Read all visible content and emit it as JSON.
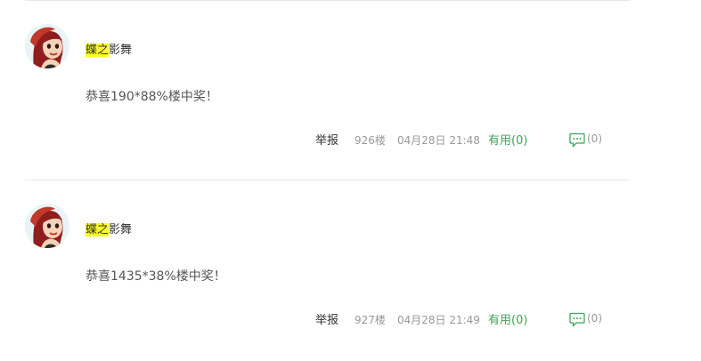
{
  "posts": [
    {
      "user": {
        "name_highlight": "蝶之",
        "name_rest": "影舞"
      },
      "content": "恭喜190*88%楼中奖！",
      "report_label": "举报",
      "floor": "926楼",
      "time": "04月28日 21:48",
      "useful_label": "有用(0)",
      "comment_count": "(0)"
    },
    {
      "user": {
        "name_highlight": "蝶之",
        "name_rest": "影舞"
      },
      "content": "恭喜1435*38%楼中奖！",
      "report_label": "举报",
      "floor": "927楼",
      "time": "04月28日 21:49",
      "useful_label": "有用(0)",
      "comment_count": "(0)"
    }
  ],
  "colors": {
    "highlight": "#ffff22",
    "useful": "#3aa757",
    "meta": "#999999",
    "divider": "#e6e6e6"
  },
  "icons": {
    "comment": "comment-bubble-icon",
    "avatar": "cartoon-girl-avatar"
  }
}
